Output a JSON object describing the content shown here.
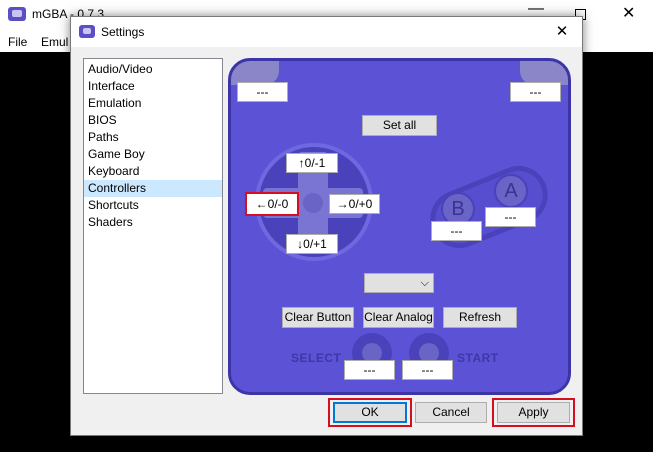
{
  "app": {
    "title": "mGBA - 0.7.3"
  },
  "menubar": {
    "file": "File",
    "emulation": "Emul"
  },
  "dialog": {
    "title": "Settings",
    "close_glyph": "✕"
  },
  "sidebar": {
    "items": [
      {
        "label": "Audio/Video"
      },
      {
        "label": "Interface"
      },
      {
        "label": "Emulation"
      },
      {
        "label": "BIOS"
      },
      {
        "label": "Paths"
      },
      {
        "label": "Game Boy"
      },
      {
        "label": "Keyboard"
      },
      {
        "label": "Controllers",
        "selected": true
      },
      {
        "label": "Shortcuts"
      },
      {
        "label": "Shaders"
      }
    ]
  },
  "controller": {
    "l_shoulder": "---",
    "r_shoulder": "---",
    "set_all": "Set all",
    "up": "↑0/-1",
    "left": "←0/-0",
    "right": "→0/+0",
    "down": "↓0/+1",
    "b_label": "B",
    "a_label": "A",
    "b_value": "---",
    "a_value": "---",
    "profile_value": "",
    "clear_button": "Clear Button",
    "clear_analog": "Clear Analog",
    "refresh": "Refresh",
    "select_label": "SELECT",
    "start_label": "START",
    "select_value": "---",
    "start_value": "---"
  },
  "footer": {
    "ok": "OK",
    "cancel": "Cancel",
    "apply": "Apply"
  },
  "colors": {
    "pad_body": "#5b52d6",
    "highlight": "#d40f20",
    "selected_item": "#cce8ff"
  }
}
